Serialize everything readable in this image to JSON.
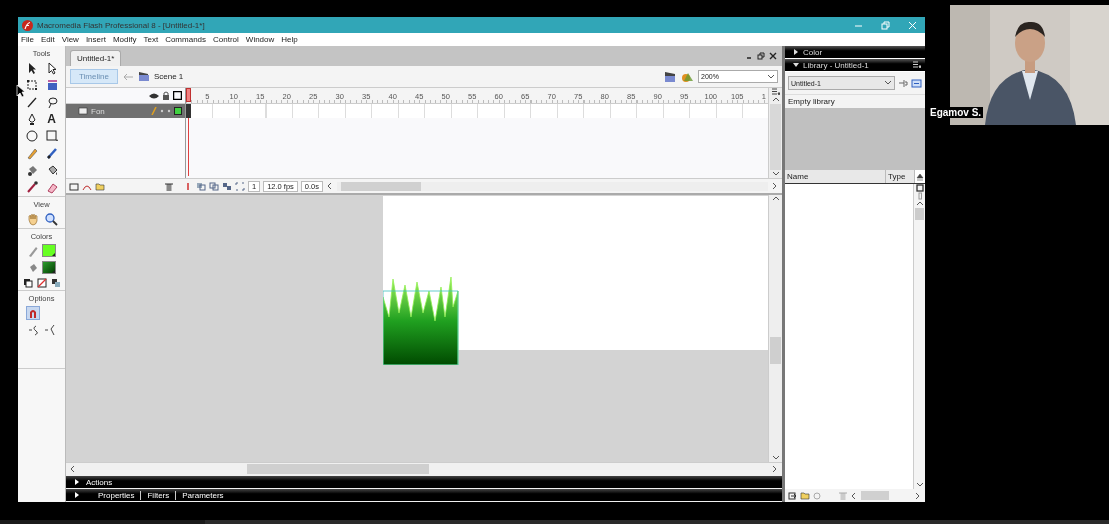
{
  "window": {
    "title": "Macromedia Flash Professional 8 - [Untitled-1*]"
  },
  "menu": [
    "File",
    "Edit",
    "View",
    "Insert",
    "Modify",
    "Text",
    "Commands",
    "Control",
    "Window",
    "Help"
  ],
  "tools": {
    "title": "Tools",
    "text_tool": "A",
    "sections": [
      "View",
      "Colors",
      "Options"
    ]
  },
  "document": {
    "tab": "Untitled-1*",
    "timeline_button": "Timeline",
    "scene": "Scene 1",
    "zoom": "200%",
    "timeline": {
      "ruler": [
        "5",
        "10",
        "15",
        "20",
        "25",
        "30",
        "35",
        "40",
        "45",
        "50",
        "55",
        "60",
        "65",
        "70",
        "75",
        "80",
        "85",
        "90",
        "95",
        "100",
        "105",
        "1"
      ],
      "layers": [
        {
          "name": "Fon",
          "selected": true
        }
      ],
      "current_frame": "1",
      "frame_rate": "12.0 fps",
      "elapsed": "0.0s"
    }
  },
  "panels": [
    {
      "kind": "color",
      "title": "Color",
      "expanded": false
    },
    {
      "kind": "library",
      "title": "Library - Untitled-1",
      "expanded": true,
      "document": "Untitled-1",
      "status": "Empty library",
      "columns": [
        "Name",
        "Type"
      ]
    }
  ],
  "bottom_panels": [
    {
      "kind": "single",
      "title": "Actions",
      "expanded": false
    },
    {
      "kind": "tabs",
      "tabs": [
        "Properties",
        "Filters",
        "Parameters"
      ],
      "expanded": false
    }
  ],
  "video": {
    "name": "Egamov S."
  }
}
